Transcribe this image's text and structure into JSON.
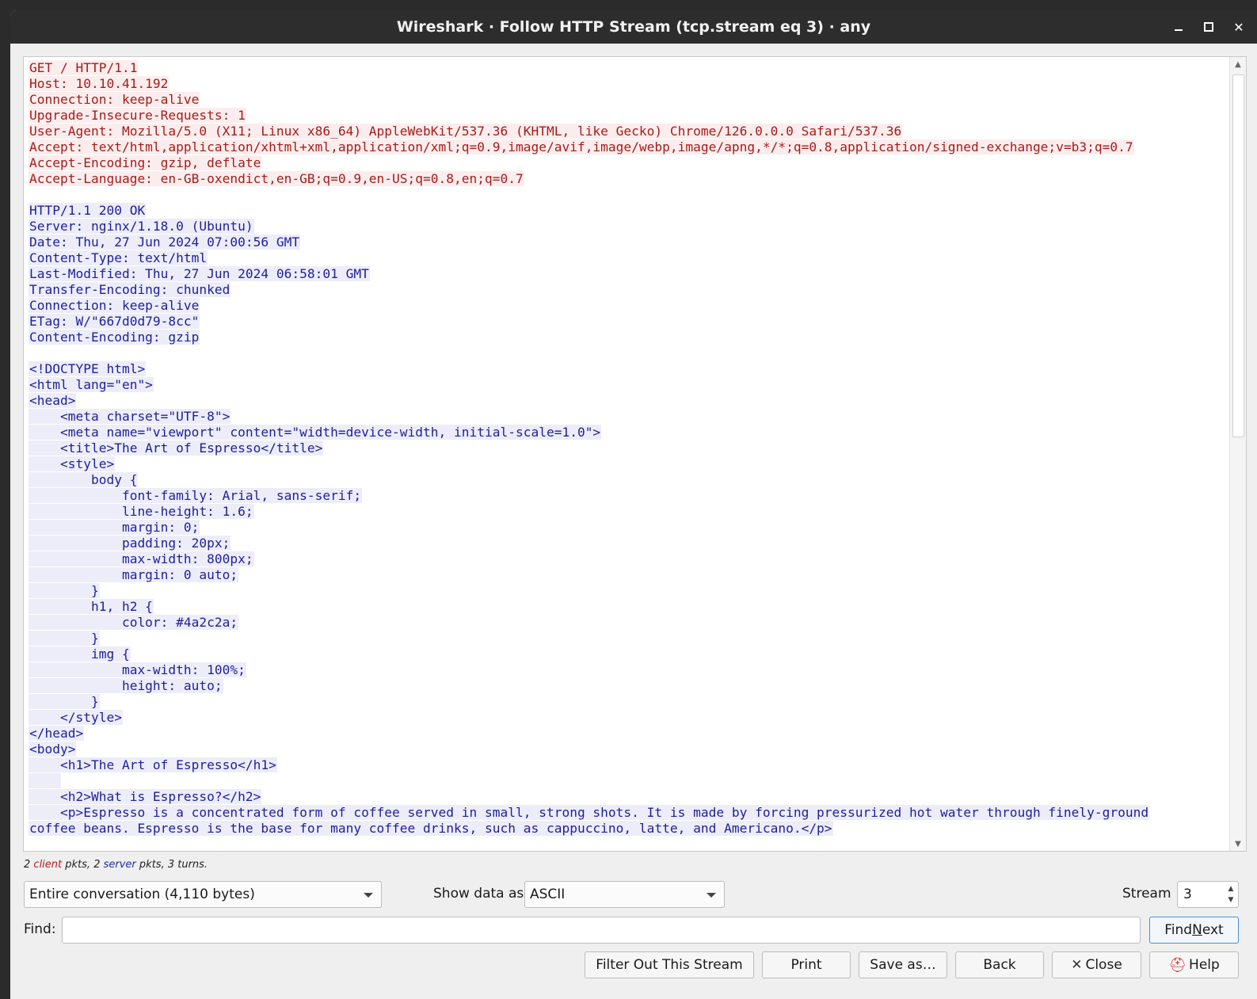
{
  "window": {
    "title": "Wireshark · Follow HTTP Stream (tcp.stream eq 3) · any",
    "controls": {
      "minimize": "minimize",
      "maximize": "maximize",
      "close": "✕"
    }
  },
  "colors": {
    "client": "#a61c1c",
    "server": "#1f1f9a"
  },
  "stream": {
    "lines": [
      {
        "who": "cli",
        "text": "GET / HTTP/1.1"
      },
      {
        "who": "cli",
        "text": "Host: 10.10.41.192"
      },
      {
        "who": "cli",
        "text": "Connection: keep-alive"
      },
      {
        "who": "cli",
        "text": "Upgrade-Insecure-Requests: 1"
      },
      {
        "who": "cli",
        "text": "User-Agent: Mozilla/5.0 (X11; Linux x86_64) AppleWebKit/537.36 (KHTML, like Gecko) Chrome/126.0.0.0 Safari/537.36"
      },
      {
        "who": "cli",
        "text": "Accept: text/html,application/xhtml+xml,application/xml;q=0.9,image/avif,image/webp,image/apng,*/*;q=0.8,application/signed-exchange;v=b3;q=0.7"
      },
      {
        "who": "cli",
        "text": "Accept-Encoding: gzip, deflate"
      },
      {
        "who": "cli",
        "text": "Accept-Language: en-GB-oxendict,en-GB;q=0.9,en-US;q=0.8,en;q=0.7"
      },
      {
        "who": "blank",
        "text": ""
      },
      {
        "who": "srv",
        "text": "HTTP/1.1 200 OK"
      },
      {
        "who": "srv",
        "text": "Server: nginx/1.18.0 (Ubuntu)"
      },
      {
        "who": "srv",
        "text": "Date: Thu, 27 Jun 2024 07:00:56 GMT"
      },
      {
        "who": "srv",
        "text": "Content-Type: text/html"
      },
      {
        "who": "srv",
        "text": "Last-Modified: Thu, 27 Jun 2024 06:58:01 GMT"
      },
      {
        "who": "srv",
        "text": "Transfer-Encoding: chunked"
      },
      {
        "who": "srv",
        "text": "Connection: keep-alive"
      },
      {
        "who": "srv",
        "text": "ETag: W/\"667d0d79-8cc\""
      },
      {
        "who": "srv",
        "text": "Content-Encoding: gzip"
      },
      {
        "who": "blank",
        "text": ""
      },
      {
        "who": "srv",
        "text": "<!DOCTYPE html>"
      },
      {
        "who": "srv",
        "text": "<html lang=\"en\">"
      },
      {
        "who": "srv",
        "text": "<head>"
      },
      {
        "who": "srv",
        "text": "    <meta charset=\"UTF-8\">"
      },
      {
        "who": "srv",
        "text": "    <meta name=\"viewport\" content=\"width=device-width, initial-scale=1.0\">"
      },
      {
        "who": "srv",
        "text": "    <title>The Art of Espresso</title>"
      },
      {
        "who": "srv",
        "text": "    <style>"
      },
      {
        "who": "srv",
        "text": "        body {"
      },
      {
        "who": "srv",
        "text": "            font-family: Arial, sans-serif;"
      },
      {
        "who": "srv",
        "text": "            line-height: 1.6;"
      },
      {
        "who": "srv",
        "text": "            margin: 0;"
      },
      {
        "who": "srv",
        "text": "            padding: 20px;"
      },
      {
        "who": "srv",
        "text": "            max-width: 800px;"
      },
      {
        "who": "srv",
        "text": "            margin: 0 auto;"
      },
      {
        "who": "srv",
        "text": "        }"
      },
      {
        "who": "srv",
        "text": "        h1, h2 {"
      },
      {
        "who": "srv",
        "text": "            color: #4a2c2a;"
      },
      {
        "who": "srv",
        "text": "        }"
      },
      {
        "who": "srv",
        "text": "        img {"
      },
      {
        "who": "srv",
        "text": "            max-width: 100%;"
      },
      {
        "who": "srv",
        "text": "            height: auto;"
      },
      {
        "who": "srv",
        "text": "        }"
      },
      {
        "who": "srv",
        "text": "    </style>"
      },
      {
        "who": "srv",
        "text": "</head>"
      },
      {
        "who": "srv",
        "text": "<body>"
      },
      {
        "who": "srv",
        "text": "    <h1>The Art of Espresso</h1>"
      },
      {
        "who": "srv",
        "text": "    "
      },
      {
        "who": "srv",
        "text": "    <h2>What is Espresso?</h2>"
      },
      {
        "who": "srv",
        "text": "    <p>Espresso is a concentrated form of coffee served in small, strong shots. It is made by forcing pressurized hot water through finely-ground"
      },
      {
        "who": "srv",
        "text": "coffee beans. Espresso is the base for many coffee drinks, such as cappuccino, latte, and Americano.</p>"
      }
    ]
  },
  "stats": {
    "client_count": "2",
    "client_word": "client",
    "mid1": " pkts, ",
    "server_count": "2",
    "server_word": "server",
    "tail": " pkts, 3 turns."
  },
  "controls": {
    "conversation": "Entire conversation (4,110 bytes)",
    "show_data_label": "Show data as",
    "show_data_value": "ASCII",
    "stream_label": "Stream",
    "stream_value": "3",
    "find_label": "Find:",
    "find_placeholder": "",
    "find_next_pre": "Find ",
    "find_next_u": "N",
    "find_next_post": "ext"
  },
  "buttons": {
    "filter_out": "Filter Out This Stream",
    "print": "Print",
    "save_as": "Save as…",
    "back": "Back",
    "close": "Close",
    "help": "Help"
  }
}
